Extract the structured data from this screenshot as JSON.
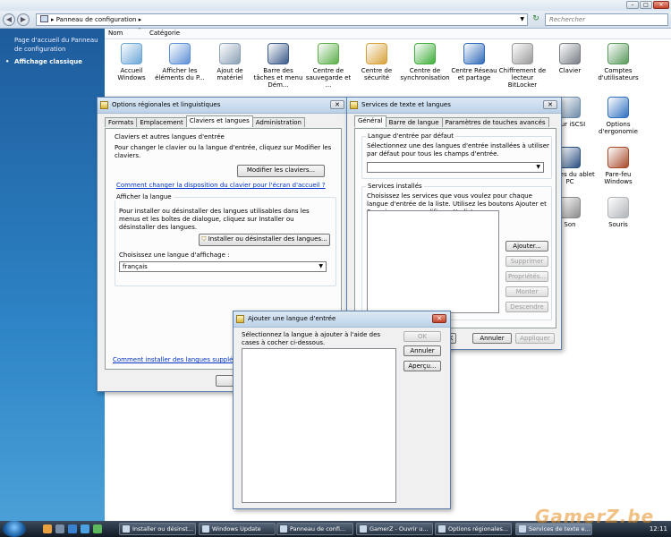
{
  "explorer": {
    "address": "Panneau de configuration",
    "search_placeholder": "Rechercher",
    "sidebar": {
      "home": "Page d'accueil du Panneau de configuration",
      "classic": "Affichage classique"
    },
    "columns": [
      "Nom",
      "Catégorie"
    ],
    "items_row1": [
      {
        "label": "Accueil Windows",
        "icon": "welcome-icon",
        "color": "#6aa7d8"
      },
      {
        "label": "Afficher les éléments du P...",
        "icon": "display-icon",
        "color": "#5c8fd6"
      },
      {
        "label": "Ajout de matériel",
        "icon": "hardware-icon",
        "color": "#8aa0b4"
      },
      {
        "label": "Barre des tâches et menu Dém...",
        "icon": "taskbar-icon",
        "color": "#3b5a8a"
      },
      {
        "label": "Centre de sauvegarde et ...",
        "icon": "backup-icon",
        "color": "#5cae4a"
      },
      {
        "label": "Centre de sécurité",
        "icon": "shield-icon",
        "color": "#d8a23a"
      },
      {
        "label": "Centre de synchronisation",
        "icon": "sync-icon",
        "color": "#3fae3a"
      },
      {
        "label": "Centre Réseau et partage",
        "icon": "network-icon",
        "color": "#2f6ab8"
      },
      {
        "label": "Chiffrement de lecteur BitLocker",
        "icon": "bitlocker-icon",
        "color": "#9a9a9a"
      },
      {
        "label": "Clavier",
        "icon": "keyboard-icon",
        "color": "#777c84"
      },
      {
        "label": "Comptes d'utilisateurs",
        "icon": "users-icon",
        "color": "#5a9a5c"
      }
    ],
    "items_right": [
      {
        "label": "teur iSCSI",
        "icon": "iscsi-icon",
        "color": "#6c8aa8"
      },
      {
        "label": "Options d'ergonomie",
        "icon": "ergonomics-icon",
        "color": "#2f70c0"
      },
      {
        "label": "mètres du ablet PC",
        "icon": "tablet-icon",
        "color": "#2a4f80"
      },
      {
        "label": "Pare-feu Windows",
        "icon": "firewall-icon",
        "color": "#a84a2a"
      },
      {
        "label": "Son",
        "icon": "speaker-icon",
        "color": "#8a8a8a"
      },
      {
        "label": "Souris",
        "icon": "mouse-icon",
        "color": "#b0b4b8"
      }
    ]
  },
  "regional": {
    "title": "Options régionales et linguistiques",
    "tabs": [
      "Formats",
      "Emplacement",
      "Claviers et langues",
      "Administration"
    ],
    "kb_group": "Claviers et autres langues d'entrée",
    "kb_text": "Pour changer le clavier ou la langue d'entrée, cliquez sur Modifier les claviers.",
    "kb_button": "Modifier les claviers...",
    "kb_link": "Comment changer la disposition du clavier pour l'écran d'accueil ?",
    "lang_group": "Afficher la langue",
    "lang_text": "Pour installer ou désinstaller des langues utilisables dans les menus et les boîtes de dialogue, cliquez sur Installer ou désinstaller des langues.",
    "lang_button": "Installer ou désinstaller des langues...",
    "choose_label": "Choisissez une langue d'affichage :",
    "choose_value": "français",
    "bottom_link": "Comment installer des langues supplément",
    "ok_partial": "O"
  },
  "text_services": {
    "title": "Services de texte et langues",
    "tabs": [
      "Général",
      "Barre de langue",
      "Paramètres de touches avancés"
    ],
    "default_group": "Langue d'entrée par défaut",
    "default_text": "Sélectionnez une des langues d'entrée installées à utiliser par défaut pour tous les champs d'entrée.",
    "default_value": "",
    "installed_group": "Services installés",
    "installed_text": "Choisissez les services que vous voulez pour chaque langue d'entrée de la liste. Utilisez les boutons Ajouter et Supprimer pour modifier cette liste.",
    "buttons": [
      "Ajouter...",
      "Supprimer",
      "Propriétés...",
      "Monter",
      "Descendre"
    ],
    "ok_partial": "K",
    "cancel": "Annuler",
    "apply": "Appliquer"
  },
  "add_lang": {
    "title": "Ajouter une langue d'entrée",
    "text": "Sélectionnez la langue à ajouter à l'aide des cases à cocher ci-dessous.",
    "ok": "OK",
    "cancel": "Annuler",
    "preview": "Aperçu..."
  },
  "taskbar": {
    "tasks": [
      "Installer ou désinst...",
      "Windows Update",
      "Panneau de confi...",
      "GamerZ - Ouvrir u...",
      "Options régionales...",
      "Services de texte e..."
    ],
    "clock": "12:11"
  },
  "watermark": "GamerZ.be"
}
